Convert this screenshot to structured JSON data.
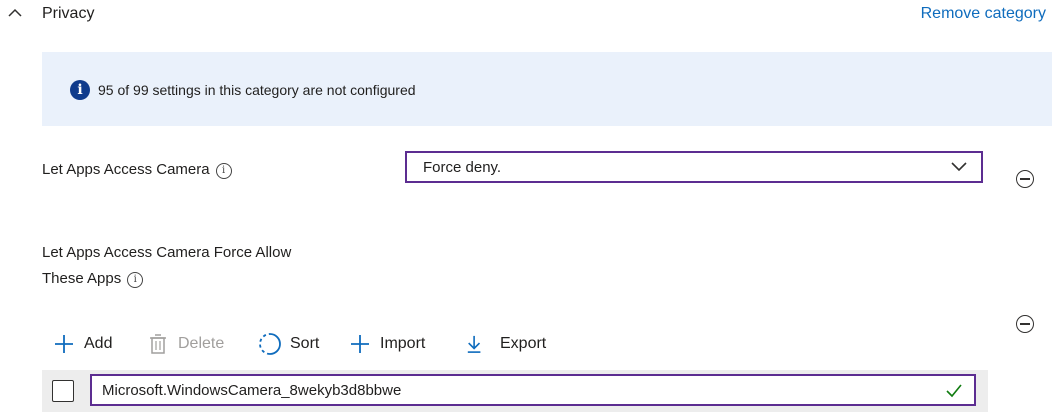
{
  "header": {
    "title": "Privacy",
    "remove_label": "Remove category"
  },
  "banner": {
    "text": "95 of 99 settings in this category are not configured",
    "icon": "info-icon",
    "bg_color": "#eaf1fb"
  },
  "camera_setting": {
    "label": "Let Apps Access Camera",
    "selected_value": "Force deny."
  },
  "force_allow": {
    "label_line1": "Let Apps Access Camera Force Allow",
    "label_line2": "These Apps",
    "toolbar": {
      "add": "Add",
      "delete": "Delete",
      "sort": "Sort",
      "import": "Import",
      "export": "Export"
    },
    "rows": [
      {
        "value": "Microsoft.WindowsCamera_8wekyb3d8bbwe",
        "checked": false,
        "valid": true
      }
    ]
  },
  "colors": {
    "accent": "#0f6cbd",
    "focus_border": "#5c2d91",
    "valid_check": "#107c10"
  }
}
